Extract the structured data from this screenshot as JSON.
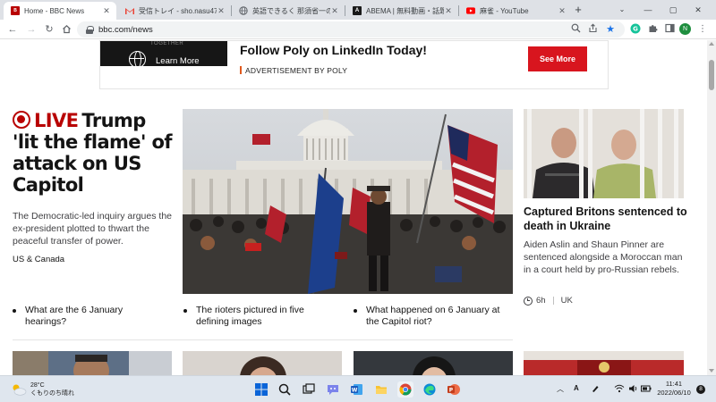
{
  "browser": {
    "tabs": [
      {
        "title": "Home - BBC News",
        "active": true,
        "favicon": "bbc-icon"
      },
      {
        "title": "受信トレイ - sho.nasu4749",
        "active": false,
        "favicon": "gmail-icon"
      },
      {
        "title": "英語できるく 那須省一のブロ",
        "active": false,
        "favicon": "globe-icon"
      },
      {
        "title": "ABEMA | 無料動画・話題の",
        "active": false,
        "favicon": "abema-icon"
      },
      {
        "title": "麻雀 - YouTube",
        "active": false,
        "favicon": "youtube-icon"
      }
    ],
    "url": "bbc.com/news",
    "profile_initial": "N"
  },
  "ad": {
    "learn_more": "Learn More",
    "together": "TOGETHER",
    "title": "Follow Poly on LinkedIn Today!",
    "byline": "ADVERTISEMENT BY POLY",
    "cta": "See More"
  },
  "main_story": {
    "live_label": "LIVE",
    "headline": "Trump 'lit the flame' of attack on US Capitol",
    "summary": "The Democratic-led inquiry argues the ex-president plotted to thwart the peaceful transfer of power.",
    "tag": "US & Canada"
  },
  "side_story": {
    "headline": "Captured Britons sentenced to death in Ukraine",
    "summary": "Aiden Aslin and Shaun Pinner are sentenced alongside a Moroccan man in a court held by pro-Russian rebels.",
    "time": "6h",
    "tag": "UK"
  },
  "related": [
    "What are the 6 January hearings?",
    "The rioters pictured in five defining images",
    "What happened on 6 January at the Capitol riot?"
  ],
  "taskbar": {
    "weather_temp": "28°C",
    "weather_desc": "くもりのち晴れ",
    "time": "11:41",
    "date": "2022/06/10",
    "notifications": "8",
    "ime": "A"
  },
  "colors": {
    "bbc_red": "#b80000",
    "ad_red": "#d8151e",
    "chrome_frame": "#dee1e6",
    "taskbar": "#dfe6ee"
  }
}
